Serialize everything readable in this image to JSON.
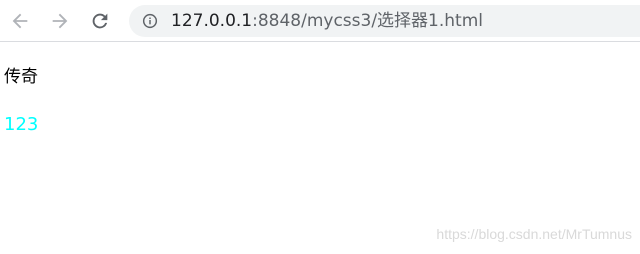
{
  "browser": {
    "address_bar": {
      "url_host": "127.0.0.1",
      "url_rest": ":8848/mycss3/选择器1.html"
    }
  },
  "page": {
    "line1": "传奇",
    "line2": "123",
    "line2_color": "#00ffff"
  },
  "watermark": "https://blog.csdn.net/MrTumnus",
  "colors": {
    "toolbar_bg": "#ffffff",
    "omnibox_bg": "#f1f3f4",
    "icon_color": "#5f6368"
  }
}
